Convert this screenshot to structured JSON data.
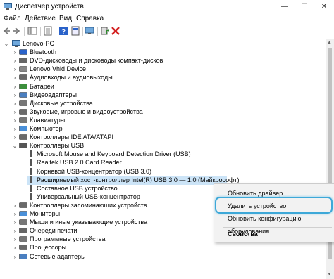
{
  "window": {
    "title": "Диспетчер устройств",
    "minimize_glyph": "—",
    "maximize_glyph": "☐",
    "close_glyph": "✕"
  },
  "menu": [
    "Файл",
    "Действие",
    "Вид",
    "Справка"
  ],
  "toolbar": {
    "icons": [
      "back-arrow-icon",
      "forward-arrow-icon",
      "show-hide-console-tree-icon",
      "properties-icon",
      "help-icon",
      "computer-monitor-icon",
      "update-driver-icon",
      "uninstall-device-icon"
    ],
    "colors": {
      "help": "#2a62c9",
      "update": "#2e8b2e",
      "uninstall": "#d32020"
    }
  },
  "tree": {
    "root": "Lenovo-PC",
    "categories": [
      {
        "label": "Bluetooth",
        "icon": "bluetooth-icon",
        "expanded": false
      },
      {
        "label": "DVD-дисководы и дисководы компакт-дисков",
        "icon": "dvd-drive-icon",
        "expanded": false
      },
      {
        "label": "Lenovo Vhid Device",
        "icon": "lenovo-device-icon",
        "expanded": false
      },
      {
        "label": "Аудиовходы и аудиовыходы",
        "icon": "audio-icon",
        "expanded": false
      },
      {
        "label": "Батареи",
        "icon": "battery-icon",
        "expanded": false
      },
      {
        "label": "Видеоадаптеры",
        "icon": "display-adapter-icon",
        "expanded": false
      },
      {
        "label": "Дисковые устройства",
        "icon": "disk-drive-icon",
        "expanded": false
      },
      {
        "label": "Звуковые, игровые и видеоустройства",
        "icon": "sound-icon",
        "expanded": false
      },
      {
        "label": "Клавиатуры",
        "icon": "keyboard-icon",
        "expanded": false
      },
      {
        "label": "Компьютер",
        "icon": "computer-icon",
        "expanded": false
      },
      {
        "label": "Контроллеры IDE ATA/ATAPI",
        "icon": "ide-controller-icon",
        "expanded": false
      },
      {
        "label": "Контроллеры USB",
        "icon": "usb-controller-icon",
        "expanded": true,
        "children": [
          "Microsoft Mouse and Keyboard Detection Driver (USB)",
          "Realtek USB 2.0 Card Reader",
          "Корневой USB-концентратор (USB 3.0)",
          "Расширяемый хост-контроллер Intel(R) USB 3.0 — 1.0 (Майкрософт)",
          "Составное USB устройство",
          "Универсальный USB-концентратор"
        ]
      },
      {
        "label": "Контроллеры запоминающих устройств",
        "icon": "storage-controller-icon",
        "expanded": false
      },
      {
        "label": "Мониторы",
        "icon": "monitor-icon",
        "expanded": false
      },
      {
        "label": "Мыши и иные указывающие устройства",
        "icon": "mouse-icon",
        "expanded": false
      },
      {
        "label": "Очереди печати",
        "icon": "print-queue-icon",
        "expanded": false
      },
      {
        "label": "Программные устройства",
        "icon": "software-device-icon",
        "expanded": false
      },
      {
        "label": "Процессоры",
        "icon": "processor-icon",
        "expanded": false
      },
      {
        "label": "Сетевые адаптеры",
        "icon": "network-adapter-icon",
        "expanded": false
      }
    ],
    "selected_index": 3
  },
  "context_menu": {
    "items": [
      "Обновить драйвер",
      "Удалить устройство",
      "Обновить конфигурацию оборудования",
      "Свойства"
    ],
    "highlighted": "Удалить устройство"
  },
  "colors": {
    "selection": "#cce4f7",
    "focus_ring": "#3da8d8",
    "menu_bg": "#f2f2f2"
  }
}
